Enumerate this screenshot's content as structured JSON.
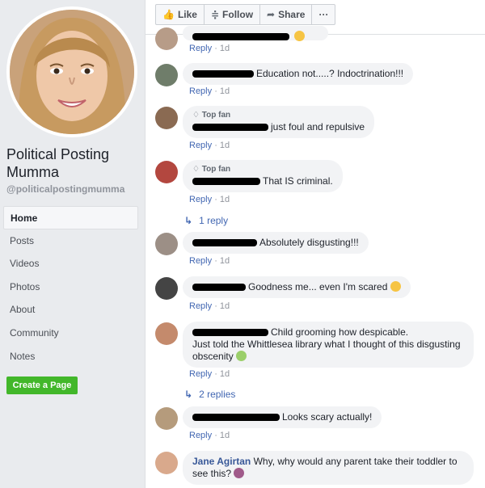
{
  "page": {
    "name": "Political Posting Mumma",
    "handle": "@politicalpostingmumma",
    "nav": [
      "Home",
      "Posts",
      "Videos",
      "Photos",
      "About",
      "Community",
      "Notes"
    ],
    "create_page": "Create a Page"
  },
  "actions": {
    "like": "Like",
    "follow": "Follow",
    "share": "Share",
    "more": "···"
  },
  "comment_meta": {
    "reply": "Reply",
    "dot": "·",
    "time": "1d"
  },
  "comments": [
    {
      "badge": "",
      "text": ""
    },
    {
      "badge": "",
      "text": "Education not.....? Indoctrination!!!"
    },
    {
      "badge": "Top fan",
      "text": "just foul and repulsive"
    },
    {
      "badge": "Top fan",
      "text": "That IS criminal."
    },
    {
      "badge": "",
      "text": "Absolutely disgusting!!!"
    },
    {
      "badge": "",
      "text": "Goodness me... even I'm scared"
    },
    {
      "badge": "",
      "text_line1": "Child grooming how despicable.",
      "text_line2": "Just told the Whittlesea library what I thought of this disgusting obscenity"
    },
    {
      "badge": "",
      "text": "Looks scary actually!"
    },
    {
      "badge": "",
      "name": "Jane Agirtan",
      "text": "Why, why would any parent take their toddler to see this?"
    }
  ],
  "reply_links": {
    "one": "1 reply",
    "two": "2 replies"
  },
  "colors": {
    "accent": "#4267b2",
    "create_button": "#42b72a",
    "bubble": "#f2f3f5"
  }
}
